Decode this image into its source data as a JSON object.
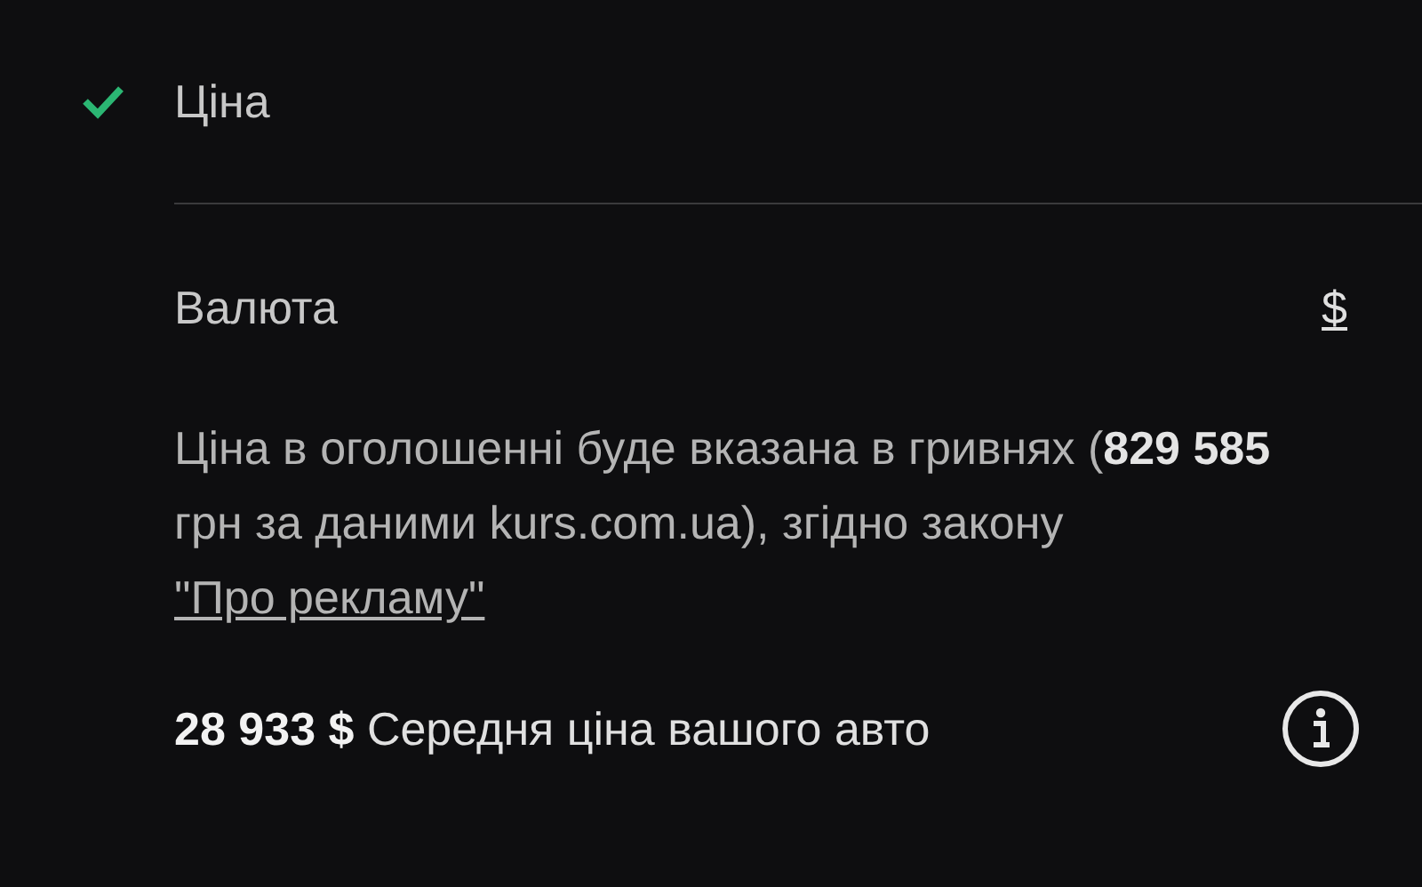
{
  "price_row": {
    "label": "Ціна",
    "checked": true
  },
  "currency_row": {
    "label": "Валюта",
    "value": "$"
  },
  "note": {
    "text": "Ціна в оголошенні буде вказана в гривнях (**829 585** грн за даними kurs.com.ua), згідно закону ",
    "link": "\"Про рекламу\""
  },
  "average": {
    "text": "**28 933 $** Середня ціна вашого авто"
  }
}
